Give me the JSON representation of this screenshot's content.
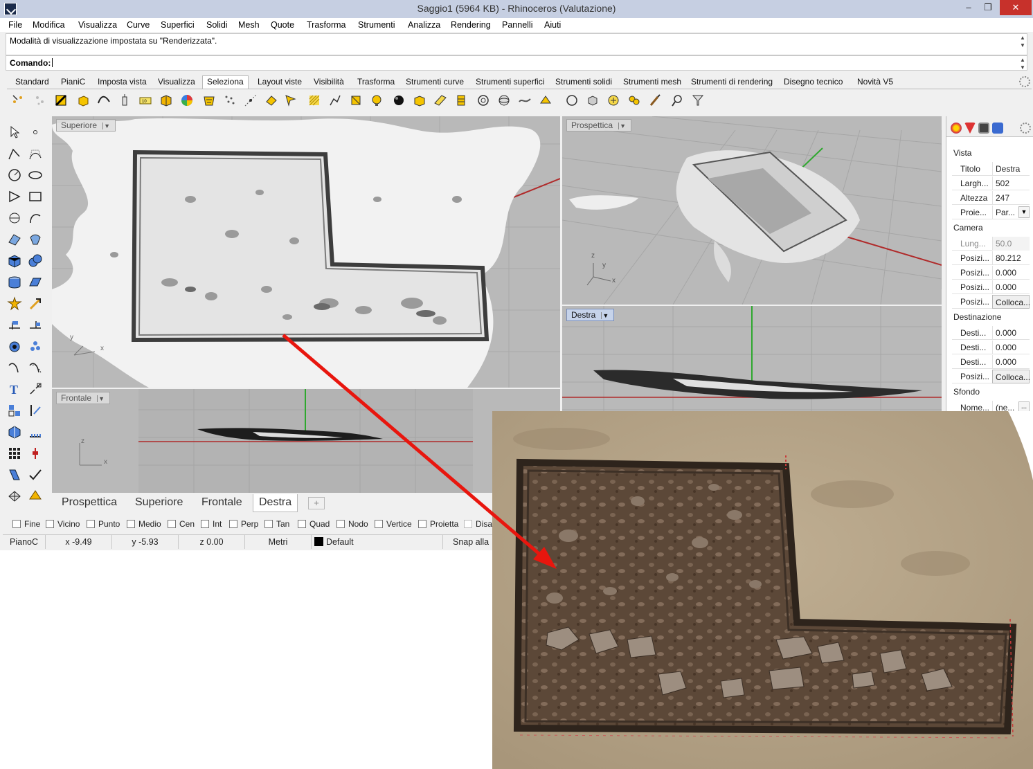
{
  "window": {
    "title": "Saggio1 (5964 KB) - Rhinoceros (Valutazione)",
    "controls": {
      "minimize": "–",
      "restore": "❐",
      "close": "✕"
    }
  },
  "menubar": [
    "File",
    "Modifica",
    "Visualizza",
    "Curve",
    "Superfici",
    "Solidi",
    "Mesh",
    "Quote",
    "Trasforma",
    "Strumenti",
    "Analizza",
    "Rendering",
    "Pannelli",
    "Aiuti"
  ],
  "command": {
    "history": "Modalità di visualizzazione impostata su \"Renderizzata\".",
    "prompt": "Comando:",
    "value": ""
  },
  "toolbar_tabs": [
    "Standard",
    "PianiC",
    "Imposta vista",
    "Visualizza",
    "Seleziona",
    "Layout viste",
    "Visibilità",
    "Trasforma",
    "Strumenti curve",
    "Strumenti superfici",
    "Strumenti solidi",
    "Strumenti mesh",
    "Strumenti di rendering",
    "Disegno tecnico",
    "Novità V5"
  ],
  "toolbar_active_tab": "Seleziona",
  "viewports": {
    "top": {
      "label": "Superiore",
      "axis_x": "x",
      "axis_y": "y"
    },
    "perspective": {
      "label": "Prospettica",
      "axis_x": "x",
      "axis_y": "y",
      "axis_z": "z"
    },
    "right": {
      "label": "Destra"
    },
    "front": {
      "label": "Frontale",
      "axis_x": "x",
      "axis_z": "z"
    }
  },
  "viewport_tabs": [
    "Prospettica",
    "Superiore",
    "Frontale",
    "Destra"
  ],
  "viewport_active_tab": "Destra",
  "viewport_tab_add": "+",
  "osnap": [
    "Fine",
    "Vicino",
    "Punto",
    "Medio",
    "Cen",
    "Int",
    "Perp",
    "Tan",
    "Quad",
    "Nodo",
    "Vertice",
    "Proietta",
    "Disa"
  ],
  "status": {
    "cplane": "PianoC",
    "x": "x -9.49",
    "y": "y -5.93",
    "z": "z 0.00",
    "units": "Metri",
    "layer": "Default",
    "snap": "Snap alla"
  },
  "properties": {
    "section_vista": "Vista",
    "titolo_k": "Titolo",
    "titolo_v": "Destra",
    "largh_k": "Largh...",
    "largh_v": "502",
    "altezza_k": "Altezza",
    "altezza_v": "247",
    "proie_k": "Proie...",
    "proie_v": "Par...",
    "section_camera": "Camera",
    "lung_k": "Lung...",
    "lung_v": "50.0",
    "pos1_k": "Posizi...",
    "pos1_v": "80.212",
    "pos2_k": "Posizi...",
    "pos2_v": "0.000",
    "pos3_k": "Posizi...",
    "pos3_v": "0.000",
    "pos4_k": "Posizi...",
    "pos4_v": "Colloca...",
    "section_dest": "Destinazione",
    "d1_k": "Desti...",
    "d1_v": "0.000",
    "d2_k": "Desti...",
    "d2_v": "0.000",
    "d3_k": "Desti...",
    "d3_v": "0.000",
    "d4_k": "Posizi...",
    "d4_v": "Colloca...",
    "section_sfondo": "Sfondo",
    "nome_k": "Nome...",
    "nome_v": "(ne...",
    "nome_btn": "..."
  },
  "colors": {
    "titlebar": "#c6cfe2",
    "viewport_bg": "#b8b8b8",
    "x_axis": "#b02a2a",
    "y_axis": "#2ea82e",
    "arrow": "#e8160e",
    "soil": "#5e4a3c"
  }
}
